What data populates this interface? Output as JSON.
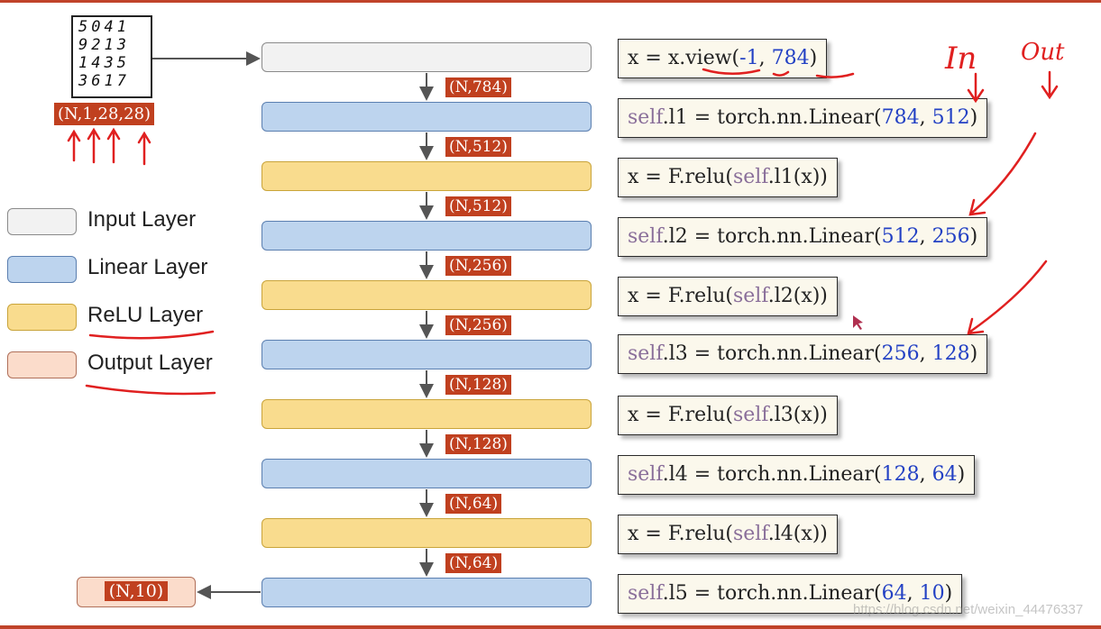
{
  "input_grid": {
    "rows": [
      "5041",
      "9213",
      "1435",
      "3617"
    ]
  },
  "input_shape": "(N,1,28,28)",
  "output_shape": "(N,10)",
  "shape_labels": [
    "(N,784)",
    "(N,512)",
    "(N,512)",
    "(N,256)",
    "(N,256)",
    "(N,128)",
    "(N,128)",
    "(N,64)",
    "(N,64)"
  ],
  "layers": [
    "input",
    "linear",
    "relu",
    "linear",
    "relu",
    "linear",
    "relu",
    "linear",
    "relu",
    "linear"
  ],
  "legend": {
    "input": "Input Layer",
    "linear": "Linear Layer",
    "relu": "ReLU Layer",
    "output": "Output Layer"
  },
  "code": {
    "l0": {
      "a": "x = x.view(",
      "n1": "-1",
      "b": ", ",
      "n2": "784",
      "c": ")"
    },
    "l1": {
      "kw": "self",
      "a": ".l1 = torch.nn.Linear(",
      "n1": "784",
      "b": ", ",
      "n2": "512",
      "c": ")"
    },
    "l2": {
      "a": "x = F.relu(",
      "kw": "self",
      "b": ".l1(x))"
    },
    "l3": {
      "kw": "self",
      "a": ".l2 = torch.nn.Linear(",
      "n1": "512",
      "b": ", ",
      "n2": "256",
      "c": ")"
    },
    "l4": {
      "a": "x = F.relu(",
      "kw": "self",
      "b": ".l2(x))"
    },
    "l5": {
      "kw": "self",
      "a": ".l3 = torch.nn.Linear(",
      "n1": "256",
      "b": ", ",
      "n2": "128",
      "c": ")"
    },
    "l6": {
      "a": "x = F.relu(",
      "kw": "self",
      "b": ".l3(x))"
    },
    "l7": {
      "kw": "self",
      "a": ".l4 = torch.nn.Linear(",
      "n1": "128",
      "b": ", ",
      "n2": "64",
      "c": ")"
    },
    "l8": {
      "a": "x = F.relu(",
      "kw": "self",
      "b": ".l4(x))"
    },
    "l9": {
      "kw": "self",
      "a": ".l5 = torch.nn.Linear(",
      "n1": "64",
      "b": ", ",
      "n2": "10",
      "c": ")"
    }
  },
  "annotations": {
    "in": "In",
    "out": "Out"
  },
  "watermark": "https://blog.csdn.net/weixin_44476337",
  "colors": {
    "input": "#f2f2f2",
    "linear": "#bdd4ee",
    "relu": "#f9dc8e",
    "output": "#fbdccb",
    "label_bg": "#c0401f",
    "annotation": "#e02020"
  }
}
